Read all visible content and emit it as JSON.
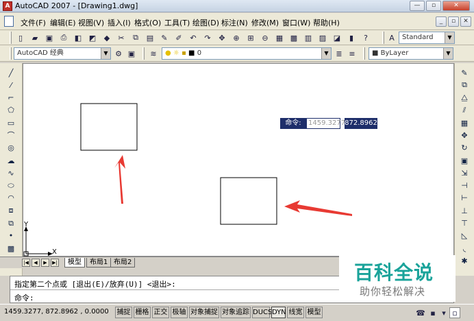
{
  "titlebar": {
    "title": "AutoCAD 2007 - [Drawing1.dwg]"
  },
  "menu": {
    "items": [
      "文件(F)",
      "编辑(E)",
      "视图(V)",
      "插入(I)",
      "格式(O)",
      "工具(T)",
      "绘图(D)",
      "标注(N)",
      "修改(M)",
      "窗口(W)",
      "帮助(H)"
    ]
  },
  "toolbar": {
    "text_style": "Standard",
    "workspace": "AutoCAD 经典",
    "layer": "0",
    "color": "ByLayer"
  },
  "layout_tabs": [
    "模型",
    "布局1",
    "布局2"
  ],
  "ucs": {
    "y_label": "Y",
    "x_label": "X"
  },
  "dynamic_input": {
    "label": "命令:",
    "x_value": "1459.3277",
    "y_value": "872.8962"
  },
  "command": {
    "history": "指定第二个点或 [退出(E)/放弃(U)] <退出>:",
    "prompt": "命令:"
  },
  "status": {
    "coords": "1459.3277, 872.8962 , 0.0000",
    "buttons": [
      "捕捉",
      "栅格",
      "正交",
      "极轴",
      "对象捕捉",
      "对象追踪",
      "DUCS",
      "DYN",
      "线宽",
      "模型"
    ]
  },
  "watermark": {
    "title": "百科全说",
    "subtitle": "助你轻松解决"
  },
  "colors": {
    "arrow": "#e83a33",
    "accent": "#1e2e6a",
    "watermark": "#1aa39a"
  }
}
